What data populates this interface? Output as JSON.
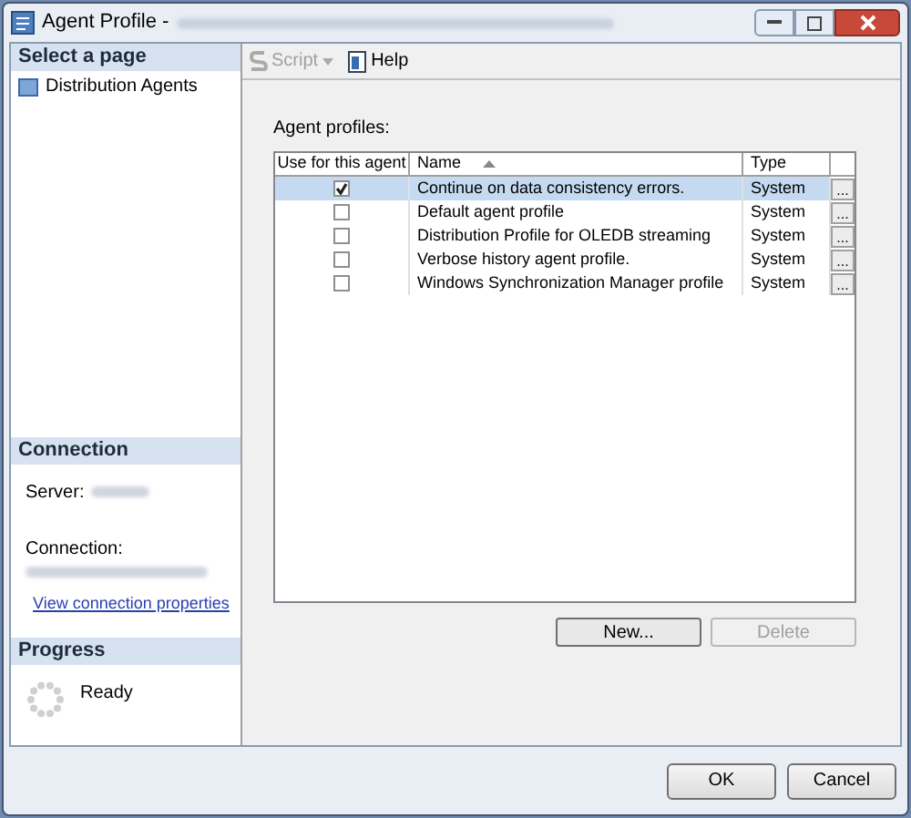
{
  "window": {
    "title": "Agent Profile -"
  },
  "sidebar": {
    "header": "Select a page",
    "items": [
      {
        "label": "Distribution Agents",
        "selected": false
      }
    ]
  },
  "connection": {
    "header": "Connection",
    "server_label": "Server:",
    "connection_label": "Connection:",
    "link": "View connection properties"
  },
  "progress": {
    "header": "Progress",
    "status": "Ready"
  },
  "toolbar": [
    {
      "label": "Script",
      "disabled": true,
      "kind": "dropdown"
    },
    {
      "label": "Help",
      "disabled": false,
      "kind": "plain"
    }
  ],
  "grid": {
    "label": "Agent profiles:",
    "columns": [
      "Use for this agent",
      "Name",
      "Type"
    ],
    "rows": [
      {
        "checked": true,
        "selected": true,
        "name": "Continue on data consistency errors.",
        "type": "System",
        "button": "..."
      },
      {
        "checked": false,
        "selected": false,
        "name": "Default agent profile",
        "type": "System",
        "button": "..."
      },
      {
        "checked": false,
        "selected": false,
        "name": "Distribution Profile for OLEDB streaming",
        "type": "System",
        "button": "..."
      },
      {
        "checked": false,
        "selected": false,
        "name": "Verbose history agent profile.",
        "type": "System",
        "button": "..."
      },
      {
        "checked": false,
        "selected": false,
        "name": "Windows Synchronization Manager profile",
        "type": "System",
        "button": "..."
      }
    ]
  },
  "grid_buttons": [
    {
      "label": "New...",
      "disabled": false
    },
    {
      "label": "Delete",
      "disabled": true
    }
  ],
  "buttons": [
    "OK",
    "Cancel"
  ]
}
